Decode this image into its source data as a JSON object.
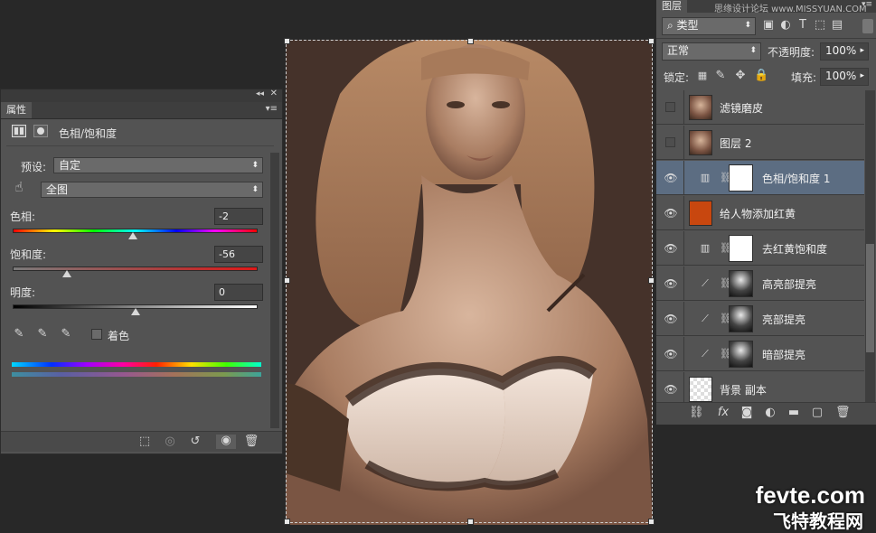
{
  "properties_panel": {
    "tab_label": "属性",
    "adjustment_title": "色相/饱和度",
    "preset_label": "预设:",
    "preset_value": "自定",
    "range_value": "全图",
    "hue_label": "色相:",
    "hue_value": "-2",
    "saturation_label": "饱和度:",
    "saturation_value": "-56",
    "lightness_label": "明度:",
    "lightness_value": "0",
    "colorize_label": "着色",
    "hue_slider_fraction": 0.49,
    "saturation_slider_fraction": 0.22,
    "lightness_slider_fraction": 0.5
  },
  "layers_panel": {
    "tab_label": "图层",
    "header_watermark": "思缘设计论坛 www.MISSYUAN.COM",
    "filter_kind": "类型",
    "blend_mode": "正常",
    "opacity_label": "不透明度:",
    "opacity_value": "100%",
    "lock_label": "锁定:",
    "fill_label": "填充:",
    "fill_value": "100%",
    "layers": [
      {
        "name": "滤镜磨皮",
        "visible": false,
        "type": "photo"
      },
      {
        "name": "图层 2",
        "visible": false,
        "type": "photo"
      },
      {
        "name": "色相/饱和度 1",
        "visible": true,
        "type": "hue-sat",
        "selected": true
      },
      {
        "name": "给人物添加红黄",
        "visible": true,
        "type": "fill",
        "color": "#c8470f"
      },
      {
        "name": "去红黄饱和度",
        "visible": true,
        "type": "hue-sat"
      },
      {
        "name": "高亮部提亮",
        "visible": true,
        "type": "curves"
      },
      {
        "name": "亮部提亮",
        "visible": true,
        "type": "curves"
      },
      {
        "name": "暗部提亮",
        "visible": true,
        "type": "curves"
      },
      {
        "name": "背景 副本",
        "visible": true,
        "type": "transparent"
      }
    ]
  },
  "watermark": {
    "domain": "fevte.com",
    "name": "飞特教程网"
  },
  "colors": {
    "panel_bg": "#535353",
    "app_bg": "#282828",
    "selected_row": "#5c6d82",
    "fill_layer_color": "#c8470f"
  }
}
